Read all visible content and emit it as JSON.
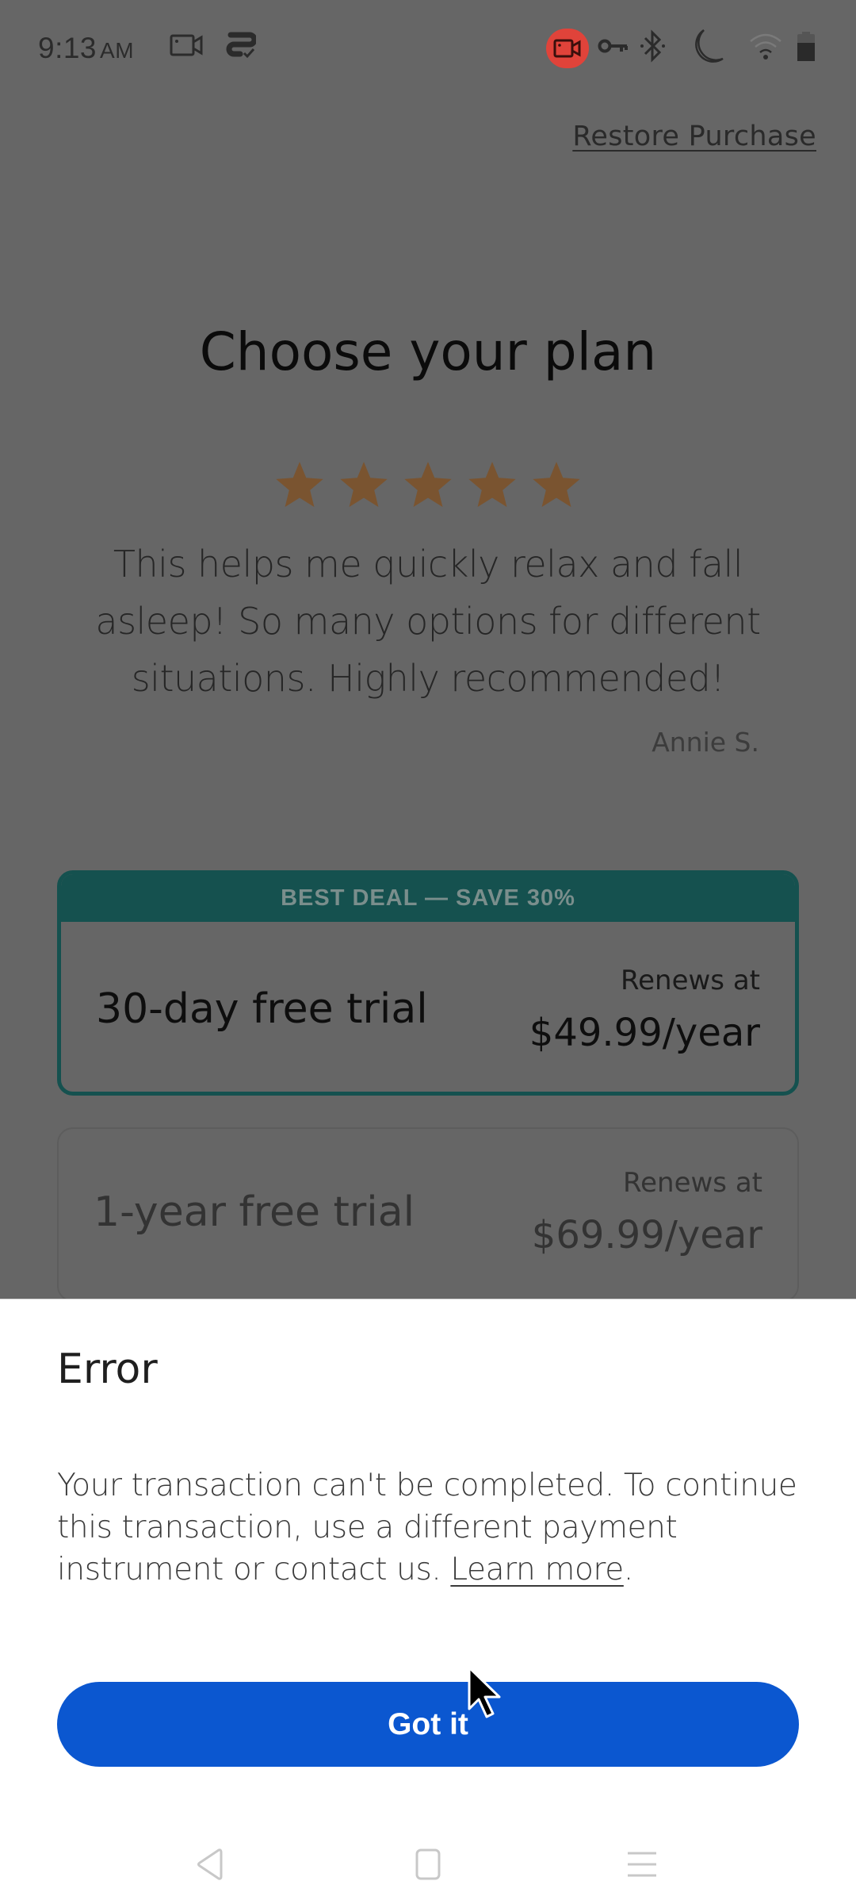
{
  "status_bar": {
    "time": "9:13",
    "ampm": "AM",
    "icons": [
      "screen-record-icon",
      "vpn-app-icon",
      "recording-active-icon",
      "vpn-key-icon",
      "bluetooth-icon",
      "do-not-disturb-icon",
      "wifi-icon",
      "battery-icon"
    ],
    "recording_badge_color": "#e0433a"
  },
  "header": {
    "restore_purchase": "Restore Purchase"
  },
  "paywall": {
    "title": "Choose your plan",
    "rating_stars": 5,
    "rating_max": 5,
    "star_color": "#7a5430",
    "review_text": "This helps me quickly relax and fall asleep! So many options for different situations. Highly recommended!",
    "reviewer": "Annie S.",
    "plans": [
      {
        "banner": "BEST DEAL — SAVE 30%",
        "name": "30-day free trial",
        "renews_label": "Renews at",
        "price": "$49.99/year",
        "selected": true
      },
      {
        "name": "1-year free trial",
        "renews_label": "Renews at",
        "price": "$69.99/year",
        "selected": false
      }
    ],
    "accent_color": "#15514f"
  },
  "error_sheet": {
    "title": "Error",
    "message": "Your transaction can't be completed. To continue this transaction, use a different payment instrument or contact us.",
    "learn_more": "Learn more",
    "trailing_punct": ".",
    "button_label": "Got it",
    "button_color": "#0b57d0"
  },
  "nav_bar": {
    "buttons": [
      "back",
      "home",
      "recents"
    ]
  }
}
